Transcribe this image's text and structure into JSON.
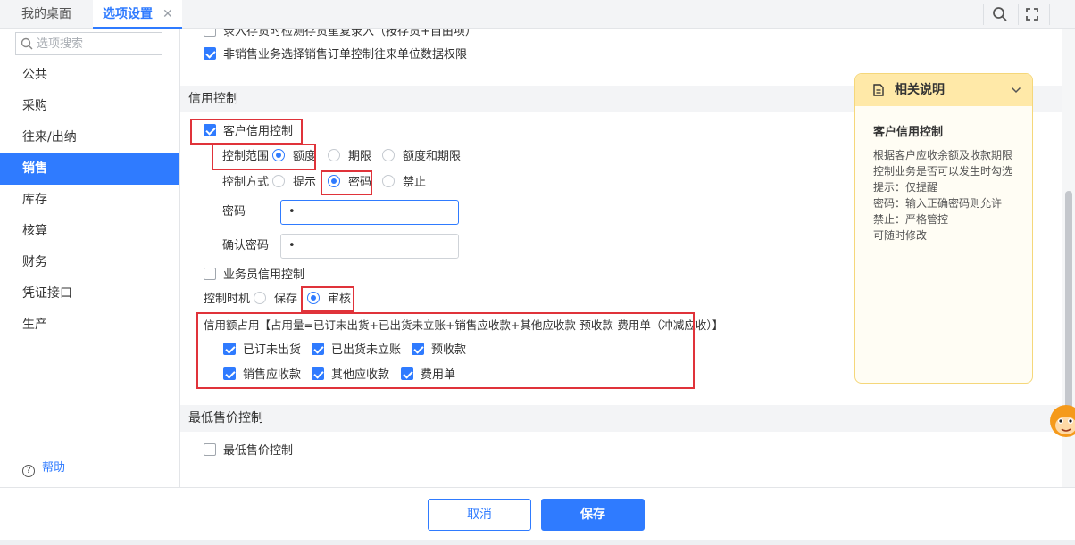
{
  "tabs": {
    "home": "我的桌面",
    "active": "选项设置",
    "close": "✕"
  },
  "sidebar": {
    "search_placeholder": "选项搜索",
    "items": [
      "公共",
      "采购",
      "往来/出纳",
      "销售",
      "库存",
      "核算",
      "财务",
      "凭证接口",
      "生产"
    ],
    "active_index": 3,
    "help": "帮助"
  },
  "main": {
    "top_options": [
      {
        "label": "录入存货时检测存货重复录入（按存货+自由项）",
        "checked": false
      },
      {
        "label": "非销售业务选择销售订单控制往来单位数据权限",
        "checked": true
      }
    ],
    "credit_section": {
      "title": "信用控制",
      "customer_credit": {
        "label": "客户信用控制",
        "checked": true
      },
      "scope": {
        "label": "控制范围",
        "options": [
          "额度",
          "期限",
          "额度和期限"
        ],
        "selected": "额度"
      },
      "method": {
        "label": "控制方式",
        "options": [
          "提示",
          "密码",
          "禁止"
        ],
        "selected": "密码"
      },
      "password": {
        "label": "密码",
        "value": "•"
      },
      "confirm_password": {
        "label": "确认密码",
        "value": "•"
      },
      "salesman_credit": {
        "label": "业务员信用控制",
        "checked": false
      },
      "timing": {
        "label": "控制时机",
        "options": [
          "保存",
          "审核"
        ],
        "selected": "审核"
      },
      "occupancy_title": "信用额占用【占用量=已订未出货+已出货未立账+销售应收款+其他应收款-预收款-费用单（冲减应收）】",
      "occupancy_items": [
        {
          "label": "已订未出货",
          "checked": true
        },
        {
          "label": "已出货未立账",
          "checked": true
        },
        {
          "label": "预收款",
          "checked": true
        },
        {
          "label": "销售应收款",
          "checked": true
        },
        {
          "label": "其他应收款",
          "checked": true
        },
        {
          "label": "费用单",
          "checked": true
        }
      ]
    },
    "min_price_section": {
      "title": "最低售价控制",
      "option": {
        "label": "最低售价控制",
        "checked": false
      }
    }
  },
  "note": {
    "header": "相关说明",
    "title": "客户信用控制",
    "lines": [
      "根据客户应收余额及收款期限",
      "控制业务是否可以发生时勾选",
      "提示：仅提醒",
      "密码：输入正确密码则允许",
      "禁止：严格管控",
      "可随时修改"
    ]
  },
  "footer": {
    "cancel": "取消",
    "save": "保存"
  },
  "colors": {
    "accent": "#2f7bff",
    "highlight_box": "#e0333a",
    "note_header": "#ffe9a8"
  },
  "icons": [
    "search-icon",
    "fullscreen-icon",
    "close-icon",
    "document-icon",
    "chevron-down-icon",
    "help-icon"
  ]
}
